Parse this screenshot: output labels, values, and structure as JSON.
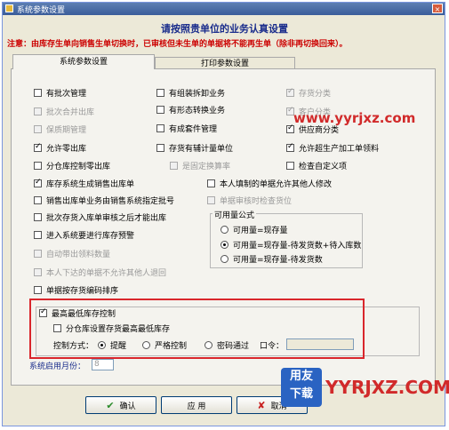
{
  "window": {
    "title": "系统参数设置",
    "close": "×"
  },
  "heading": "请按照贵单位的业务认真设置",
  "note": "注意：由库存生单向销售生单切换时，已审核但未生单的单据将不能再生单（除非再切换回来）。",
  "tabs": [
    "系统参数设置",
    "打印参数设置"
  ],
  "checkboxes": [
    {
      "label": "有批次管理",
      "checked": false,
      "disabled": false
    },
    {
      "label": "批次合并出库",
      "checked": false,
      "disabled": true
    },
    {
      "label": "保质期管理",
      "checked": false,
      "disabled": true
    },
    {
      "label": "允许零出库",
      "checked": true,
      "disabled": false
    },
    {
      "label": "分仓库控制零出库",
      "checked": false,
      "disabled": false
    },
    {
      "label": "库存系统生成销售出库单",
      "checked": true,
      "disabled": false
    },
    {
      "label": "销售出库单业务由销售系统指定批号",
      "checked": false,
      "disabled": false
    },
    {
      "label": "批次存货入库单审核之后才能出库",
      "checked": false,
      "disabled": false
    },
    {
      "label": "进入系统要进行库存预警",
      "checked": false,
      "disabled": false
    },
    {
      "label": "自动带出领料数量",
      "checked": false,
      "disabled": true
    },
    {
      "label": "本人下达的单据不允许其他人退回",
      "checked": false,
      "disabled": true
    },
    {
      "label": "单据按存货编码排序",
      "checked": false,
      "disabled": false
    },
    {
      "label": "有组装拆卸业务",
      "checked": false,
      "disabled": false
    },
    {
      "label": "有形态转换业务",
      "checked": false,
      "disabled": false
    },
    {
      "label": "有成套件管理",
      "checked": false,
      "disabled": false
    },
    {
      "label": "存货有辅计量单位",
      "checked": false,
      "disabled": false
    },
    {
      "label": "是固定换算率",
      "checked": false,
      "disabled": true
    },
    {
      "label": "本人填制的单据允许其他人修改",
      "checked": false,
      "disabled": false
    },
    {
      "label": "单据审核时检查货位",
      "checked": false,
      "disabled": true
    },
    {
      "label": "存货分类",
      "checked": true,
      "disabled": true
    },
    {
      "label": "客户分类",
      "checked": true,
      "disabled": true
    },
    {
      "label": "供应商分类",
      "checked": true,
      "disabled": false
    },
    {
      "label": "允许超生产加工单领料",
      "checked": true,
      "disabled": false
    },
    {
      "label": "检查自定义项",
      "checked": false,
      "disabled": false
    }
  ],
  "available": {
    "title": "可用量公式",
    "options": [
      "可用量=现存量",
      "可用量=现存量-待发货数+待入库数",
      "可用量=现存量-待发货数"
    ],
    "selected": 1
  },
  "maxstock": {
    "main": "最高最低库存控制",
    "main_checked": true,
    "sub": "分仓库设置存货最高最低库存",
    "sub_checked": false,
    "mode_label": "控制方式：",
    "modes": [
      "提醒",
      "严格控制",
      "密码通过"
    ],
    "mode_selected": 0,
    "password_label": "口令："
  },
  "month": {
    "label": "系统启用月份：",
    "value": "8"
  },
  "buttons": {
    "ok": "确认",
    "ok_icon": "✔",
    "apply": "应 用",
    "cancel": "取消",
    "cancel_icon": "✘"
  },
  "watermark": {
    "top": "www.yyrjxz.com",
    "bottom": "YYRJXZ.COM",
    "logo_line1": "用友",
    "logo_line2": "下载"
  }
}
